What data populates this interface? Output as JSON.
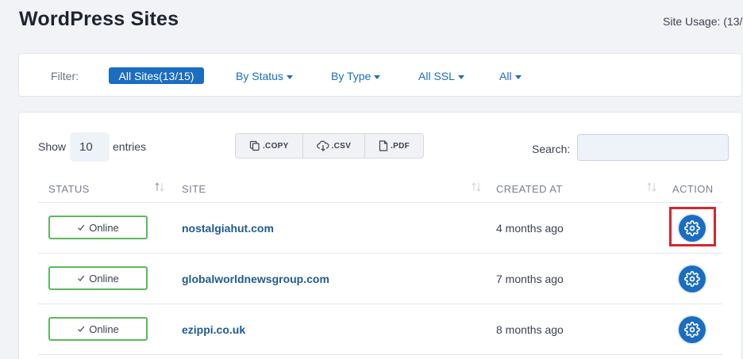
{
  "header": {
    "title": "WordPress Sites",
    "site_usage": "Site Usage: (13/"
  },
  "filter": {
    "label": "Filter:",
    "active": "All Sites(13/15)",
    "dropdowns": [
      "By Status",
      "By Type",
      "All SSL",
      "All"
    ]
  },
  "table_controls": {
    "show_label": "Show",
    "entries_value": "10",
    "entries_label": "entries",
    "exports": [
      ".COPY",
      ".CSV",
      ".PDF"
    ],
    "search_label": "Search:",
    "search_value": ""
  },
  "columns": [
    "STATUS",
    "SITE",
    "CREATED AT",
    "ACTION"
  ],
  "rows": [
    {
      "status": "Online",
      "site": "nostalgiahut.com",
      "created": "4 months ago"
    },
    {
      "status": "Online",
      "site": "globalworldnewsgroup.com",
      "created": "7 months ago"
    },
    {
      "status": "Online",
      "site": "ezippi.co.uk",
      "created": "8 months ago"
    }
  ],
  "colors": {
    "accent": "#1b6dc1",
    "online_border": "#5cb85c",
    "highlight": "#d7262d"
  }
}
